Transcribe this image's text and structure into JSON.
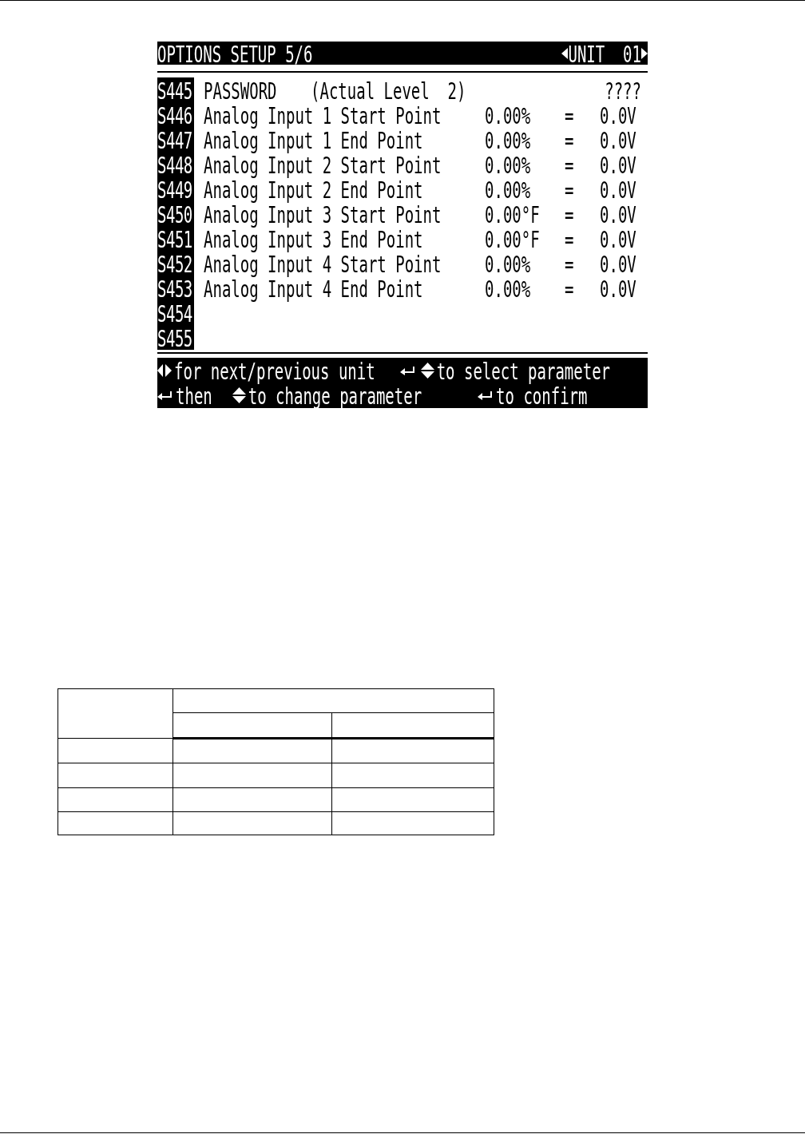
{
  "lcd": {
    "title": "OPTIONS SETUP 5/6",
    "unit": "UNIT  01",
    "parameters": [
      {
        "kind": "password",
        "id": "S445",
        "name": "PASSWORD",
        "note": "(Actual Level  2)",
        "value": "????"
      },
      {
        "kind": "analog",
        "id": "S446",
        "name": "Analog Input 1 Start Point",
        "value": "0.00%",
        "separator": "=",
        "voltage": "0.0V"
      },
      {
        "kind": "analog",
        "id": "S447",
        "name": "Analog Input 1 End Point",
        "value": "0.00%",
        "separator": "=",
        "voltage": "0.0V"
      },
      {
        "kind": "analog",
        "id": "S448",
        "name": "Analog Input 2 Start Point",
        "value": "0.00%",
        "separator": "=",
        "voltage": "0.0V"
      },
      {
        "kind": "analog",
        "id": "S449",
        "name": "Analog Input 2 End Point",
        "value": "0.00%",
        "separator": "=",
        "voltage": "0.0V"
      },
      {
        "kind": "analog",
        "id": "S450",
        "name": "Analog Input 3 Start Point",
        "value": "0.00°F",
        "separator": "=",
        "voltage": "0.0V"
      },
      {
        "kind": "analog",
        "id": "S451",
        "name": "Analog Input 3 End Point",
        "value": "0.00°F",
        "separator": "=",
        "voltage": "0.0V"
      },
      {
        "kind": "analog",
        "id": "S452",
        "name": "Analog Input 4 Start Point",
        "value": "0.00%",
        "separator": "=",
        "voltage": "0.0V"
      },
      {
        "kind": "analog",
        "id": "S453",
        "name": "Analog Input 4 End Point",
        "value": "0.00%",
        "separator": "=",
        "voltage": "0.0V"
      },
      {
        "kind": "empty",
        "id": "S454"
      },
      {
        "kind": "empty",
        "id": "S455"
      }
    ],
    "hint_lines": [
      {
        "hints": [
          {
            "kind": "left_right",
            "text": "for next/previous unit"
          },
          {
            "kind": "enter_up_down",
            "text": "to select parameter"
          }
        ]
      },
      {
        "hints": [
          {
            "kind": "enter",
            "text": "then"
          },
          {
            "kind": "up_down",
            "text": "to change parameter"
          },
          {
            "kind": "enter",
            "text": "to confirm"
          }
        ]
      }
    ]
  }
}
